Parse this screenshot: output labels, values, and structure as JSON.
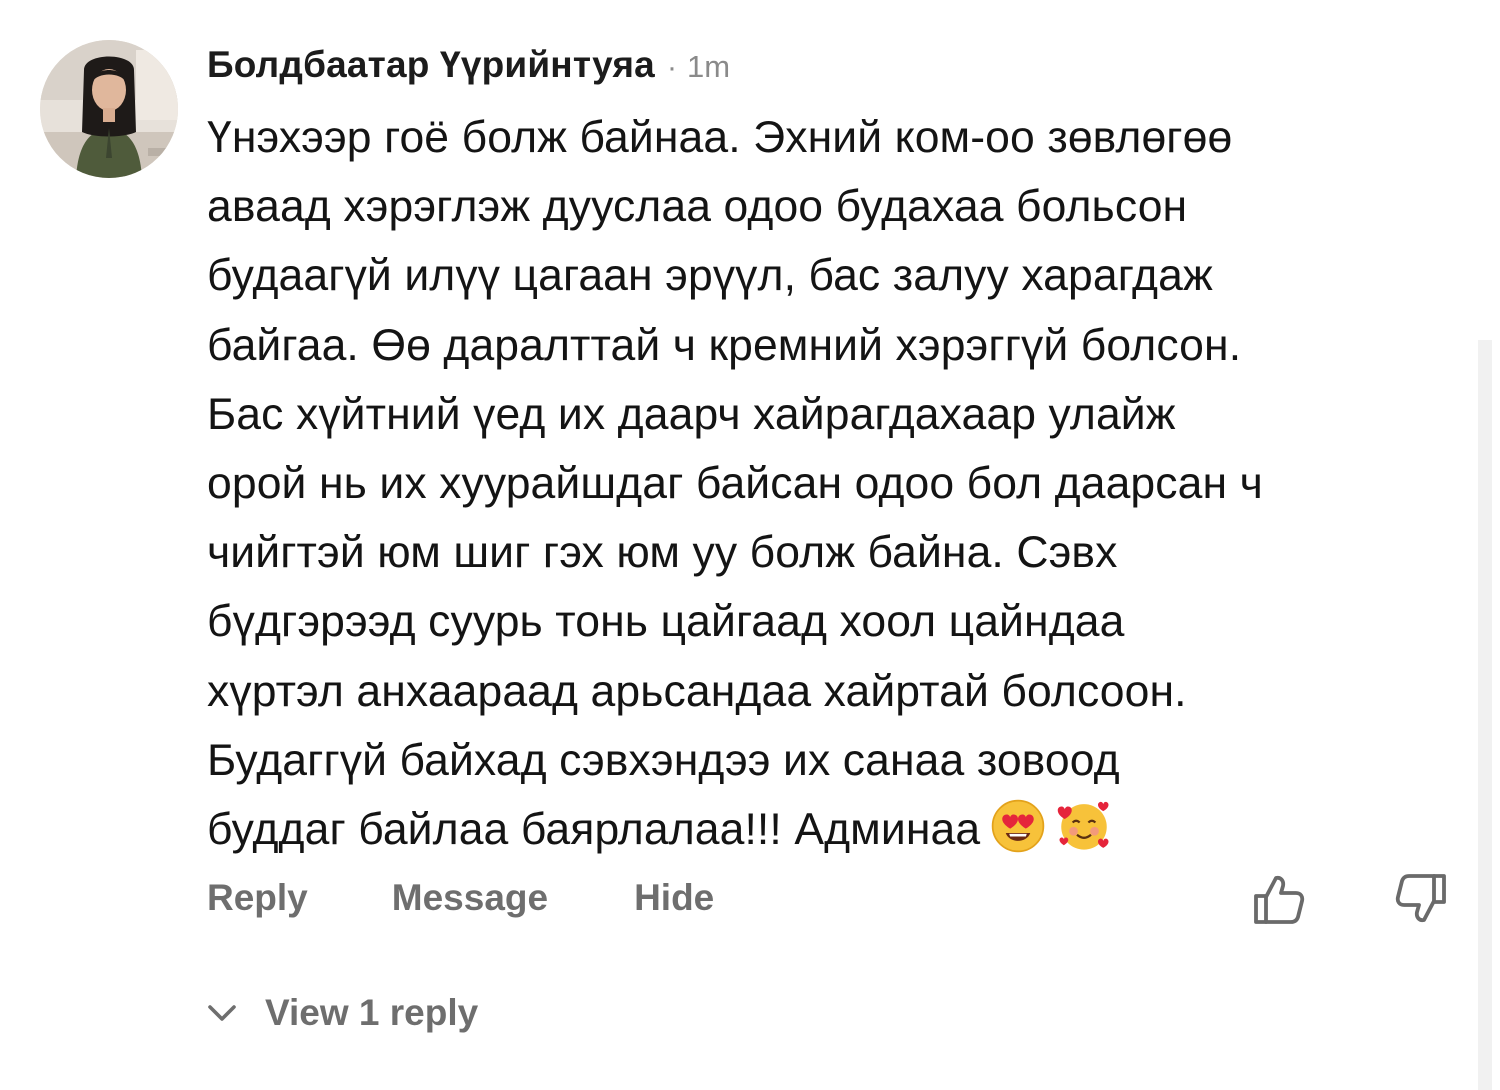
{
  "comment": {
    "author": "Болдбаатар Үүрийнтуяа",
    "separator": "·",
    "time": "1m",
    "text": "Үнэхээр гоё болж байнаа. Эхний ком-оо зөвлөгөө\nаваад хэрэглэж дууслаа одоо будахаа больсон\nбудаагүй илүү цагаан эрүүл, бас залуу харагдаж\nбайгаа. Өө даралттай ч кремний хэрэггүй болсон.\nБас хүйтний үед их даарч хайрагдахаар улайж\nорой нь их хуурайшдаг байсан одоо бол даарсан ч\nчийгтэй юм шиг гэх юм уу болж байна. Сэвх\nбүдгэрээд суурь тонь цайгаад хоол цайндаа\nхүртэл анхаараад арьсандаа хайртай болсоон.\nБудаггүй байхад сэвхэндээ их санаа зовоод\nбуддаг байлаа баярлалаа!!! Админаа",
    "emojis": [
      "heart-eyes-emoji",
      "smiling-face-with-hearts-emoji"
    ]
  },
  "actions": {
    "reply": "Reply",
    "message": "Message",
    "hide": "Hide"
  },
  "icons": {
    "upvote": "thumbs-up-icon",
    "downvote": "thumbs-down-icon",
    "expand": "chevron-down-icon"
  },
  "replies": {
    "label": "View 1 reply"
  },
  "colors": {
    "text": "#141414",
    "muted": "#6e6e6e",
    "meta": "#8a8a8a"
  }
}
